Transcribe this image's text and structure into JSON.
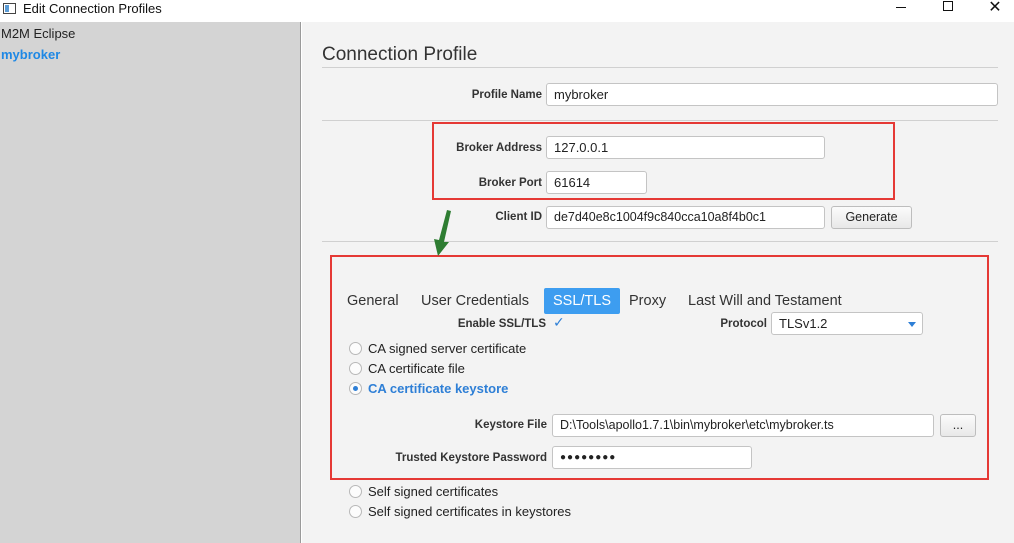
{
  "window": {
    "title": "Edit Connection Profiles",
    "minimize": "",
    "maximize": "",
    "close": "✕"
  },
  "sidebar": {
    "items": [
      {
        "label": "M2M Eclipse",
        "selected": false
      },
      {
        "label": "mybroker",
        "selected": true
      }
    ]
  },
  "main": {
    "heading": "Connection Profile",
    "profile_name_label": "Profile Name",
    "profile_name_value": "mybroker",
    "broker_address_label": "Broker Address",
    "broker_address_value": "127.0.0.1",
    "broker_port_label": "Broker Port",
    "broker_port_value": "61614",
    "client_id_label": "Client ID",
    "client_id_value": "de7d40e8c1004f9c840cca10a8f4b0c1",
    "generate_label": "Generate"
  },
  "tabs": [
    {
      "label": "General",
      "active": false
    },
    {
      "label": "User Credentials",
      "active": false
    },
    {
      "label": "SSL/TLS",
      "active": true
    },
    {
      "label": "Proxy",
      "active": false
    },
    {
      "label": "Last Will and Testament",
      "active": false
    }
  ],
  "ssl": {
    "enable_label": "Enable SSL/TLS",
    "enable_checked": true,
    "check_glyph": "✓",
    "protocol_label": "Protocol",
    "protocol_value": "TLSv1.2",
    "options": [
      {
        "label": "CA signed server certificate",
        "selected": false
      },
      {
        "label": "CA certificate file",
        "selected": false
      },
      {
        "label": "CA certificate keystore",
        "selected": true
      }
    ],
    "keystore_file_label": "Keystore File",
    "keystore_file_value": "D:\\Tools\\apollo1.7.1\\bin\\mybroker\\etc\\mybroker.ts",
    "browse_label": "...",
    "password_label": "Trusted Keystore Password",
    "password_value": "●●●●●●●●",
    "other_options": [
      {
        "label": "Self signed certificates",
        "selected": false
      },
      {
        "label": "Self signed certificates in keystores",
        "selected": false
      }
    ]
  },
  "colors": {
    "accent": "#3d9df0",
    "highlight_box": "#e53935",
    "arrow": "#2e7d32"
  }
}
